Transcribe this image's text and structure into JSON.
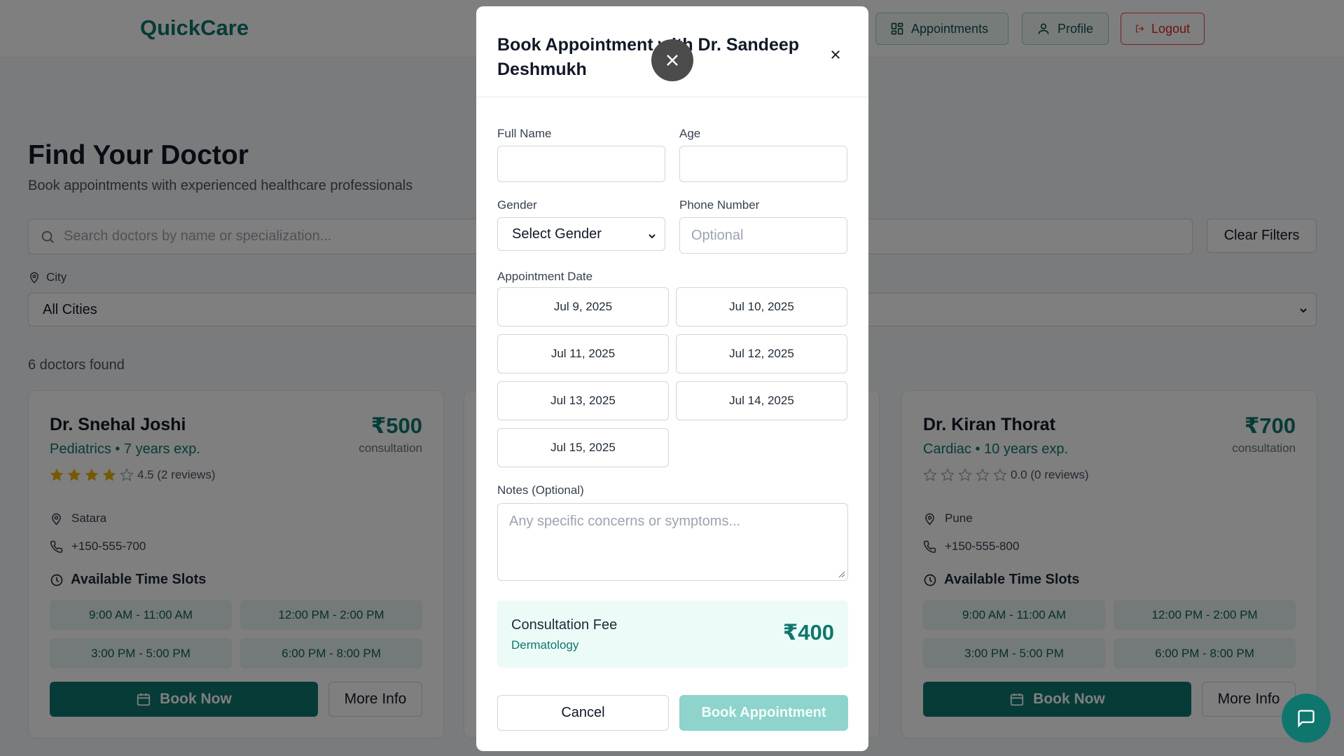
{
  "header": {
    "brand": "QuickCare",
    "nav": {
      "appointments": "Appointments",
      "profile": "Profile",
      "logout": "Logout"
    }
  },
  "page": {
    "title": "Find Your Doctor",
    "subtitle": "Book appointments with experienced healthcare professionals",
    "search_placeholder": "Search doctors by name or specialization...",
    "clear_filters": "Clear Filters",
    "city_label": "City",
    "city_value": "All Cities",
    "found_text": "6 doctors found"
  },
  "doctors": [
    {
      "name": "Dr. Snehal Joshi",
      "specialty_line": "Pediatrics • 7 years exp.",
      "fee": "₹500",
      "fee_label": "consultation",
      "rating": 4,
      "rating_text": "4.5 (2 reviews)",
      "city": "Satara",
      "phone": "+150-555-700",
      "slots_title": "Available Time Slots",
      "slots": [
        "9:00 AM - 11:00 AM",
        "12:00 PM - 2:00 PM",
        "3:00 PM - 5:00 PM",
        "6:00 PM - 8:00 PM"
      ],
      "book_label": "Book Now",
      "more_label": "More Info"
    },
    {
      "name": "Dr. Kiran Thorat",
      "specialty_line": "Cardiac • 10 years exp.",
      "fee": "₹700",
      "fee_label": "consultation",
      "rating": 0,
      "rating_text": "0.0 (0 reviews)",
      "city": "Pune",
      "phone": "+150-555-800",
      "slots_title": "Available Time Slots",
      "slots": [
        "9:00 AM - 11:00 AM",
        "12:00 PM - 2:00 PM",
        "3:00 PM - 5:00 PM",
        "6:00 PM - 8:00 PM"
      ],
      "book_label": "Book Now",
      "more_label": "More Info"
    }
  ],
  "modal": {
    "title": "Book Appointment with Dr. Sandeep Deshmukh",
    "full_name_label": "Full Name",
    "full_name_value": "",
    "age_label": "Age",
    "age_value": "",
    "gender_label": "Gender",
    "gender_value": "Select Gender",
    "phone_label": "Phone Number",
    "phone_placeholder": "Optional",
    "date_label": "Appointment Date",
    "dates": [
      "Jul 9, 2025",
      "Jul 10, 2025",
      "Jul 11, 2025",
      "Jul 12, 2025",
      "Jul 13, 2025",
      "Jul 14, 2025",
      "Jul 15, 2025"
    ],
    "notes_label": "Notes (Optional)",
    "notes_placeholder": "Any specific concerns or symptoms...",
    "fee_label": "Consultation Fee",
    "fee_specialty": "Dermatology",
    "fee_value": "₹400",
    "cancel_label": "Cancel",
    "submit_label": "Book Appointment"
  },
  "colors": {
    "brand": "#0f766e",
    "danger": "#dc2626",
    "star": "#eab308"
  }
}
